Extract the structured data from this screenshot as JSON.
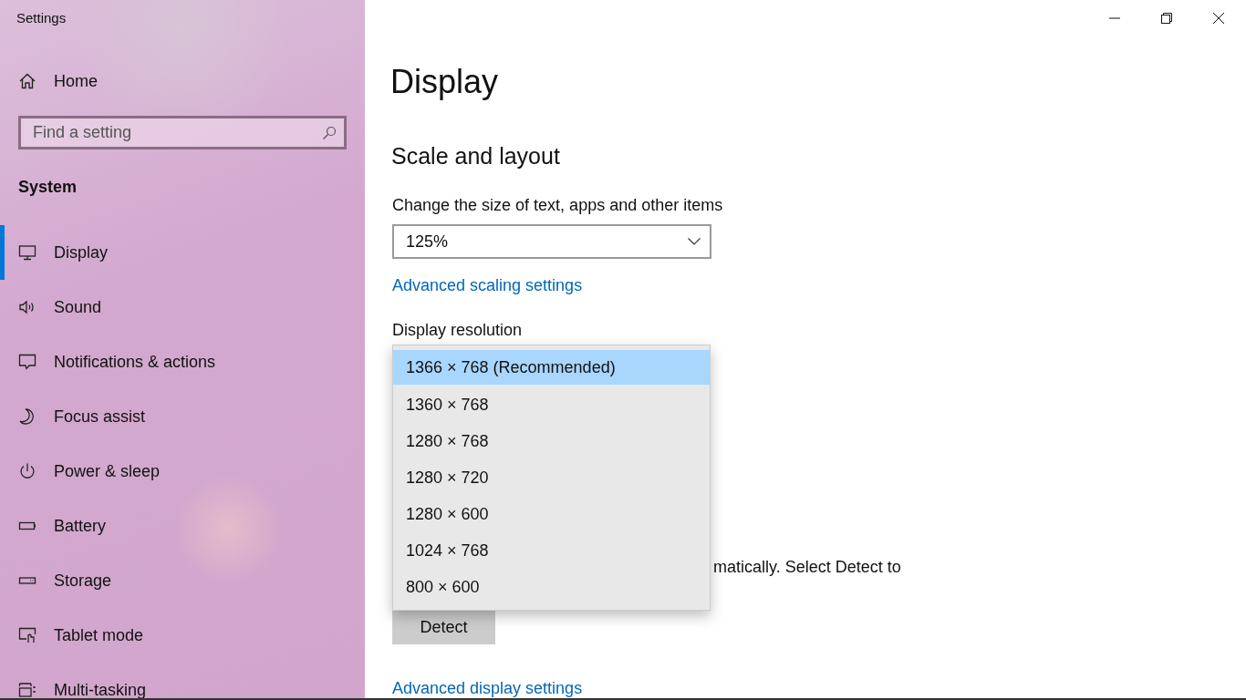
{
  "window": {
    "title": "Settings"
  },
  "sidebar": {
    "home": "Home",
    "search": {
      "placeholder": "Find a setting"
    },
    "section": "System",
    "items": [
      {
        "label": "Display",
        "selected": true
      },
      {
        "label": "Sound",
        "selected": false
      },
      {
        "label": "Notifications & actions",
        "selected": false
      },
      {
        "label": "Focus assist",
        "selected": false
      },
      {
        "label": "Power & sleep",
        "selected": false
      },
      {
        "label": "Battery",
        "selected": false
      },
      {
        "label": "Storage",
        "selected": false
      },
      {
        "label": "Tablet mode",
        "selected": false
      },
      {
        "label": "Multi-tasking",
        "selected": false
      }
    ]
  },
  "page": {
    "title": "Display",
    "section": "Scale and layout",
    "scale_label": "Change the size of text, apps and other items",
    "scale_value": "125%",
    "scaling_link": "Advanced scaling settings",
    "resolution_label": "Display resolution",
    "resolution_options": [
      {
        "label": "1366 × 768 (Recommended)",
        "selected": true
      },
      {
        "label": "1360 × 768",
        "selected": false
      },
      {
        "label": "1280 × 768",
        "selected": false
      },
      {
        "label": "1280 × 720",
        "selected": false
      },
      {
        "label": "1280 × 600",
        "selected": false
      },
      {
        "label": "1024 × 768",
        "selected": false
      },
      {
        "label": "800 × 600",
        "selected": false
      }
    ],
    "detect_text": "matically. Select Detect to",
    "detect_button": "Detect",
    "display_link": "Advanced display settings"
  }
}
